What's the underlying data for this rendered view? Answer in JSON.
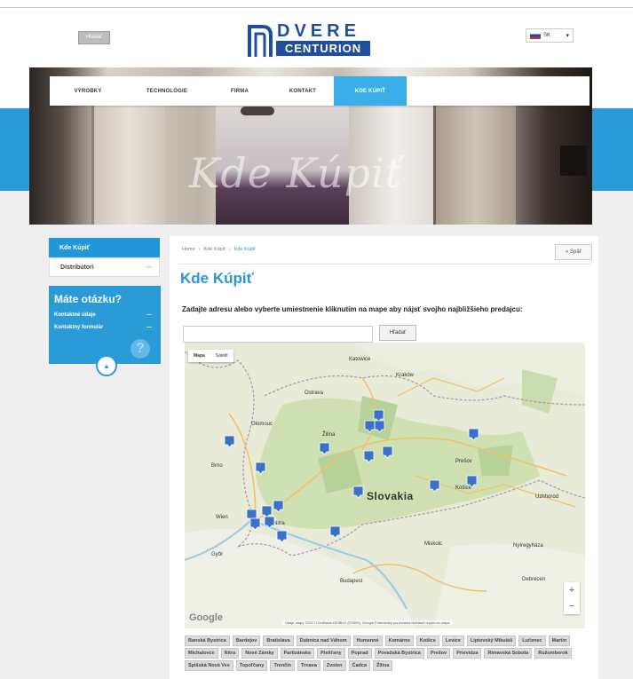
{
  "header": {
    "search_label": "Hľadať",
    "logo_top": "DVERE",
    "logo_bottom": "CENTURION",
    "language": "SK"
  },
  "nav": {
    "items": [
      "VÝROBKY",
      "TECHNOLÓGIE",
      "FIRMA",
      "KONTAKT",
      "KDE KÚPIŤ"
    ],
    "active_index": 4
  },
  "hero": {
    "title": "Kde Kúpiť"
  },
  "sidebar": {
    "items": [
      "Kde Kúpiť",
      "Distribútori"
    ],
    "box": {
      "title": "Máte otázku?",
      "links": [
        "Kontaktné údaje",
        "Kontaktný formulár"
      ]
    }
  },
  "main": {
    "breadcrumb": [
      "Home",
      "Kde Kúpiť",
      "Kde Kúpiť"
    ],
    "back_label": "« Späť",
    "heading": "Kde Kúpiť",
    "instructions": "Zadajte adresu alebo vyberte umiestnenie kliknutím na mape aby nájsť svojho najbližšieho predajcu:",
    "search_button": "Hľadať",
    "address_value": ""
  },
  "map": {
    "type_buttons": [
      "Mapa",
      "Satelit"
    ],
    "country_label": "Slovakia",
    "cities": [
      "Katowice",
      "Kraków",
      "Ostrava",
      "Olomouc",
      "Brno",
      "Žilina",
      "Prešov",
      "Košice",
      "Nitra",
      "Bratislava",
      "Wien",
      "Győr",
      "Miskolc",
      "Budapest",
      "Debrecen",
      "Nyíregyháza",
      "Uzhhorod"
    ],
    "zoom_in": "+",
    "zoom_out": "−",
    "brand": "Google",
    "attribution": "Údaje mapy ©2017 GeoBasis-DE/BKG (©2009), Google  Podmienky používania  Nahlásiť chybu na mape",
    "marker_color": "#3b72c8"
  },
  "city_list": [
    "Banská Bystrica",
    "Bardejov",
    "Bratislava",
    "Dubnica nad Váhom",
    "Humenné",
    "Komárno",
    "Košice",
    "Levice",
    "Liptovský Mikuláš",
    "Lučenec",
    "Martin",
    "Michalovce",
    "Nitra",
    "Nové Zámky",
    "Partizánske",
    "Piešťany",
    "Poprad",
    "Považská Bystrica",
    "Prešov",
    "Prievidza",
    "Rimavská Sobota",
    "Ružomberok",
    "Spišská Nová Ves",
    "Topoľčany",
    "Trenčín",
    "Trnava",
    "Zvolen",
    "Čadca",
    "Žilina"
  ],
  "colors": {
    "accent": "#2a9bd6",
    "heading": "#2a95d5",
    "logo": "#1e4f9c"
  }
}
